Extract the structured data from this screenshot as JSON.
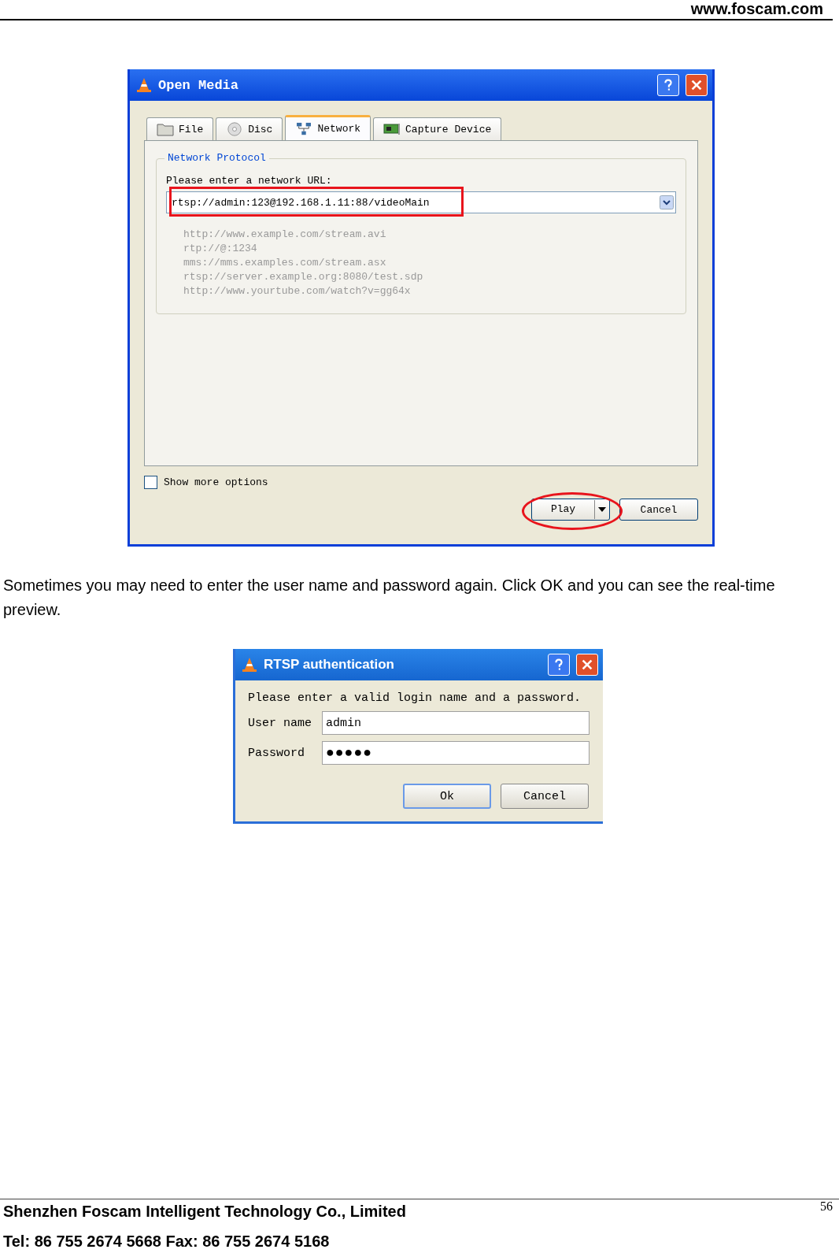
{
  "header": {
    "url": "www.foscam.com"
  },
  "open_media": {
    "title": "Open Media",
    "tabs": [
      {
        "label": "File",
        "kind": "folder",
        "selected": false
      },
      {
        "label": "Disc",
        "kind": "disc",
        "selected": false
      },
      {
        "label": "Network",
        "kind": "network",
        "selected": true
      },
      {
        "label": "Capture Device",
        "kind": "card",
        "selected": false
      }
    ],
    "group_title": "Network Protocol",
    "url_label": "Please enter a network URL:",
    "url_value": "rtsp://admin:123@192.168.1.11:88/videoMain",
    "examples": [
      "http://www.example.com/stream.avi",
      "rtp://@:1234",
      "mms://mms.examples.com/stream.asx",
      "rtsp://server.example.org:8080/test.sdp",
      "http://www.yourtube.com/watch?v=gg64x"
    ],
    "show_more": {
      "label": "Show more options",
      "checked": false
    },
    "buttons": [
      {
        "label": "Play",
        "kind": "split"
      },
      {
        "label": "Cancel",
        "kind": "plain"
      }
    ]
  },
  "paragraph": "Sometimes you may need to enter the user name and password again. Click OK and you can see the real-time preview.",
  "rtsp_auth": {
    "title": "RTSP authentication",
    "prompt": "Please enter a valid login name and a password.",
    "fields": [
      {
        "label": "User name",
        "value": "admin"
      },
      {
        "label": "Password",
        "value": "●●●●●"
      }
    ],
    "buttons": [
      {
        "label": "Ok",
        "default": true
      },
      {
        "label": "Cancel",
        "default": false
      }
    ]
  },
  "footer": {
    "company": "Shenzhen Foscam Intelligent Technology Co., Limited",
    "contact": "Tel: 86 755 2674 5668 Fax: 86 755 2674 5168",
    "page": "56"
  }
}
